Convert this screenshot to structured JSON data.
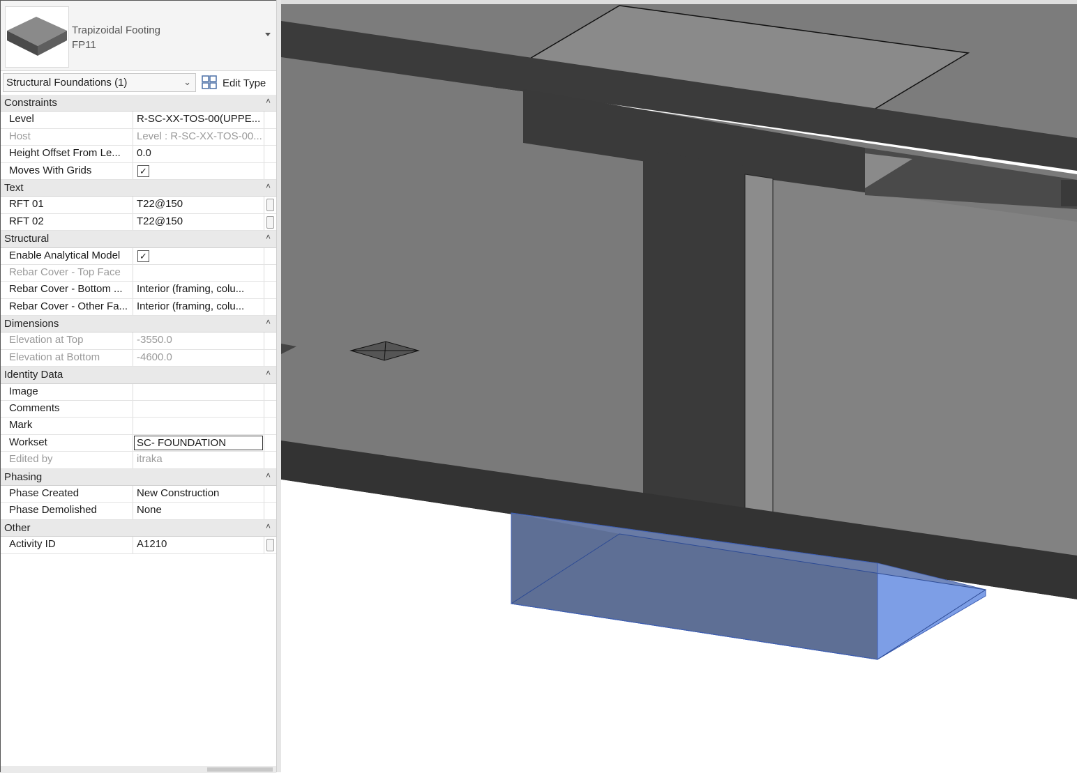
{
  "type_selector": {
    "family": "Trapizoidal Footing",
    "type": "FP11"
  },
  "instance_selector": {
    "label": "Structural Foundations (1)",
    "edit_type_label": "Edit Type"
  },
  "groups": [
    {
      "name": "Constraints",
      "rows": [
        {
          "name": "Level",
          "value": "R-SC-XX-TOS-00(UPPE..."
        },
        {
          "name": "Host",
          "value": "Level : R-SC-XX-TOS-00...",
          "readonly": true
        },
        {
          "name": "Height Offset From Le...",
          "value": "0.0"
        },
        {
          "name": "Moves With Grids",
          "checkbox": true,
          "checked": true
        }
      ]
    },
    {
      "name": "Text",
      "rows": [
        {
          "name": "RFT 01",
          "value": "T22@150",
          "button": true
        },
        {
          "name": "RFT 02",
          "value": "T22@150",
          "button": true
        }
      ]
    },
    {
      "name": "Structural",
      "rows": [
        {
          "name": "Enable Analytical Model",
          "checkbox": true,
          "checked": true
        },
        {
          "name": "Rebar Cover - Top Face",
          "value": "",
          "readonly": true
        },
        {
          "name": "Rebar Cover - Bottom ...",
          "value": "Interior (framing, colu..."
        },
        {
          "name": "Rebar Cover - Other Fa...",
          "value": "Interior (framing, colu..."
        }
      ]
    },
    {
      "name": "Dimensions",
      "rows": [
        {
          "name": "Elevation at Top",
          "value": "-3550.0",
          "readonly": true
        },
        {
          "name": "Elevation at Bottom",
          "value": "-4600.0",
          "readonly": true
        }
      ]
    },
    {
      "name": "Identity Data",
      "rows": [
        {
          "name": "Image",
          "value": ""
        },
        {
          "name": "Comments",
          "value": ""
        },
        {
          "name": "Mark",
          "value": ""
        },
        {
          "name": "Workset",
          "value": "SC- FOUNDATION",
          "editing": true
        },
        {
          "name": "Edited by",
          "value": "itraka",
          "readonly": true
        }
      ]
    },
    {
      "name": "Phasing",
      "rows": [
        {
          "name": "Phase Created",
          "value": "New Construction"
        },
        {
          "name": "Phase Demolished",
          "value": "None"
        }
      ]
    },
    {
      "name": "Other",
      "rows": [
        {
          "name": "Activity ID",
          "value": "A1210",
          "button": true
        }
      ]
    }
  ],
  "icons": {
    "type_thumbnail": "footing-thumbnail-icon",
    "edit_type": "edit-type-icon",
    "collapse": "collapse-chevron-icon",
    "checkbox": "checkbox-icon"
  },
  "colors": {
    "slab_dark": "#3a3a3a",
    "face_grey": "#7f7f7f",
    "selected_blue": "#7d9ee6"
  }
}
